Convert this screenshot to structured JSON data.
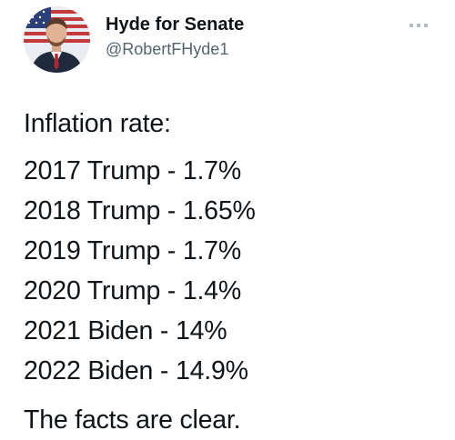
{
  "author": {
    "display_name": "Hyde for Senate",
    "handle": "@RobertFHyde1"
  },
  "icons": {
    "more": "more-horizontal-icon",
    "avatar": "profile-photo-avatar"
  },
  "colors": {
    "text_primary": "#0f1419",
    "text_secondary": "#536471",
    "background": "#ffffff"
  },
  "tweet": {
    "heading": "Inflation rate:",
    "lines": [
      "2017 Trump - 1.7%",
      "2018 Trump - 1.65%",
      "2019 Trump - 1.7%",
      "2020 Trump - 1.4%",
      "2021 Biden - 14%",
      "2022 Biden - 14.9%"
    ],
    "closing": "The facts are clear."
  }
}
